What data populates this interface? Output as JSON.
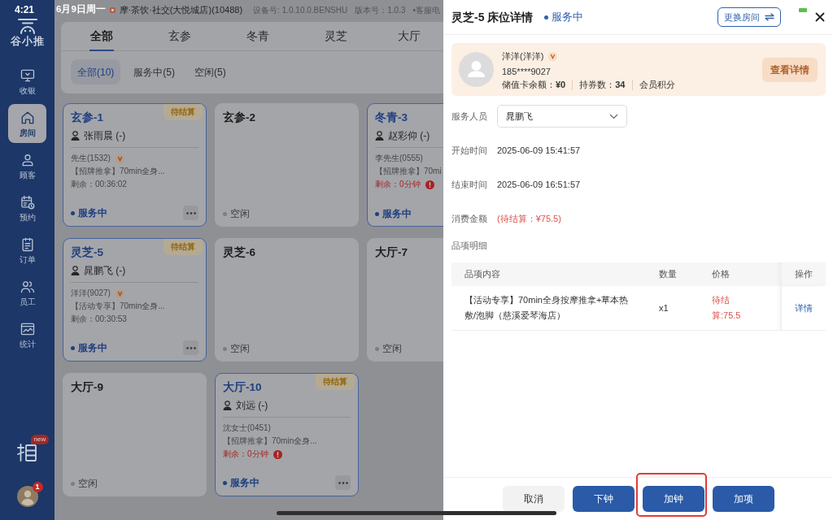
{
  "status_bar": {
    "time": "4:21",
    "date": "6月9日周一"
  },
  "sidebar": {
    "logo": "谷小推",
    "items": [
      {
        "label": "收银",
        "selected": false
      },
      {
        "label": "房间",
        "selected": true
      },
      {
        "label": "顾客",
        "selected": false
      },
      {
        "label": "预约",
        "selected": false
      },
      {
        "label": "订单",
        "selected": false
      },
      {
        "label": "员工",
        "selected": false
      },
      {
        "label": "统计",
        "selected": false
      }
    ],
    "promo_badge": "new",
    "profile_badge": "1"
  },
  "header": {
    "store": "摩·茶饮·社交(大悦城店)(10488)",
    "device": "设备号: 1.0.10.0.BENSHU",
    "version": "版本号：1.0.3",
    "service": "•客服电"
  },
  "area_tabs": [
    {
      "label": "全部",
      "selected": true
    },
    {
      "label": "玄参",
      "selected": false
    },
    {
      "label": "冬青",
      "selected": false
    },
    {
      "label": "灵芝",
      "selected": false
    },
    {
      "label": "大厅",
      "selected": false
    }
  ],
  "filters": [
    {
      "label": "全部(10)",
      "selected": true
    },
    {
      "label": "服务中(5)",
      "selected": false
    },
    {
      "label": "空闲(5)",
      "selected": false
    }
  ],
  "rooms": [
    {
      "name": "玄参-1",
      "kind": "busy",
      "badge": "待结算",
      "staff": "张雨晨 (-)",
      "customer": "先生(1532)",
      "member": true,
      "service": "【招牌推拿】70min全身...",
      "remaining": "剩余：00:36:02",
      "overdue": false,
      "status": "服务中"
    },
    {
      "name": "玄参-2",
      "kind": "idle",
      "status": "空闲"
    },
    {
      "name": "冬青-3",
      "kind": "busy",
      "staff": "赵彩仰 (-)",
      "customer": "李先生(0555)",
      "member": false,
      "service": "【招牌推拿】70mi",
      "remaining": "剩余：0分钟",
      "overdue": true,
      "status": "服务中"
    },
    {
      "name": "灵芝-5",
      "kind": "busy",
      "badge": "待结算",
      "staff": "晁鹏飞 (-)",
      "customer": "洋洋(9027)",
      "member": true,
      "service": "【活动专享】70min全身...",
      "remaining": "剩余：00:30:53",
      "overdue": false,
      "status": "服务中"
    },
    {
      "name": "灵芝-6",
      "kind": "idle",
      "status": "空闲"
    },
    {
      "name": "大厅-7",
      "kind": "idle",
      "status": "空闲"
    },
    {
      "name": "大厅-9",
      "kind": "idle",
      "status": "空闲"
    },
    {
      "name": "大厅-10",
      "kind": "busy",
      "badge": "待结算",
      "staff": "刘远 (-)",
      "customer": "沈女士(0451)",
      "member": false,
      "service": "【招牌推拿】70min全身...",
      "remaining": "剩余：0分钟",
      "overdue": true,
      "status": "服务中"
    }
  ],
  "drawer": {
    "title": "灵芝-5 床位详情",
    "status": "服务中",
    "change_room": "更换房间",
    "member": {
      "name": "洋洋(洋洋)",
      "vip": true,
      "phone": "185****9027",
      "stats": [
        "储值卡余额：**¥0**",
        "持券数：**34**",
        "会员积分"
      ],
      "detail_button": "查看详情"
    },
    "fields": [
      {
        "kind": "select",
        "label": "服务人员",
        "value": "晁鹏飞"
      },
      {
        "kind": "text",
        "label": "开始时间",
        "value": "2025-06-09 15:41:57"
      },
      {
        "kind": "text",
        "label": "结束时间",
        "value": "2025-06-09 16:51:57"
      },
      {
        "kind": "alert",
        "label": "消费金额",
        "value": "(待结算：¥75.5)"
      },
      {
        "kind": "heading",
        "label": "品项明细"
      }
    ],
    "table": {
      "columns": [
        "品项内容",
        "数量",
        "价格",
        "操作"
      ],
      "rows": [
        {
          "content": "【活动专享】70min全身按摩推拿+草本热敷/泡脚（慈溪爱琴海店）",
          "quantity": "x1",
          "price": "待结算:75.5",
          "action": "详情"
        }
      ]
    },
    "buttons": [
      {
        "label": "取消",
        "kind": "secondary",
        "highlighted": false
      },
      {
        "label": "下钟",
        "kind": "primary",
        "highlighted": false
      },
      {
        "label": "加钟",
        "kind": "primary",
        "highlighted": true
      },
      {
        "label": "加项",
        "kind": "primary",
        "highlighted": false
      }
    ]
  }
}
